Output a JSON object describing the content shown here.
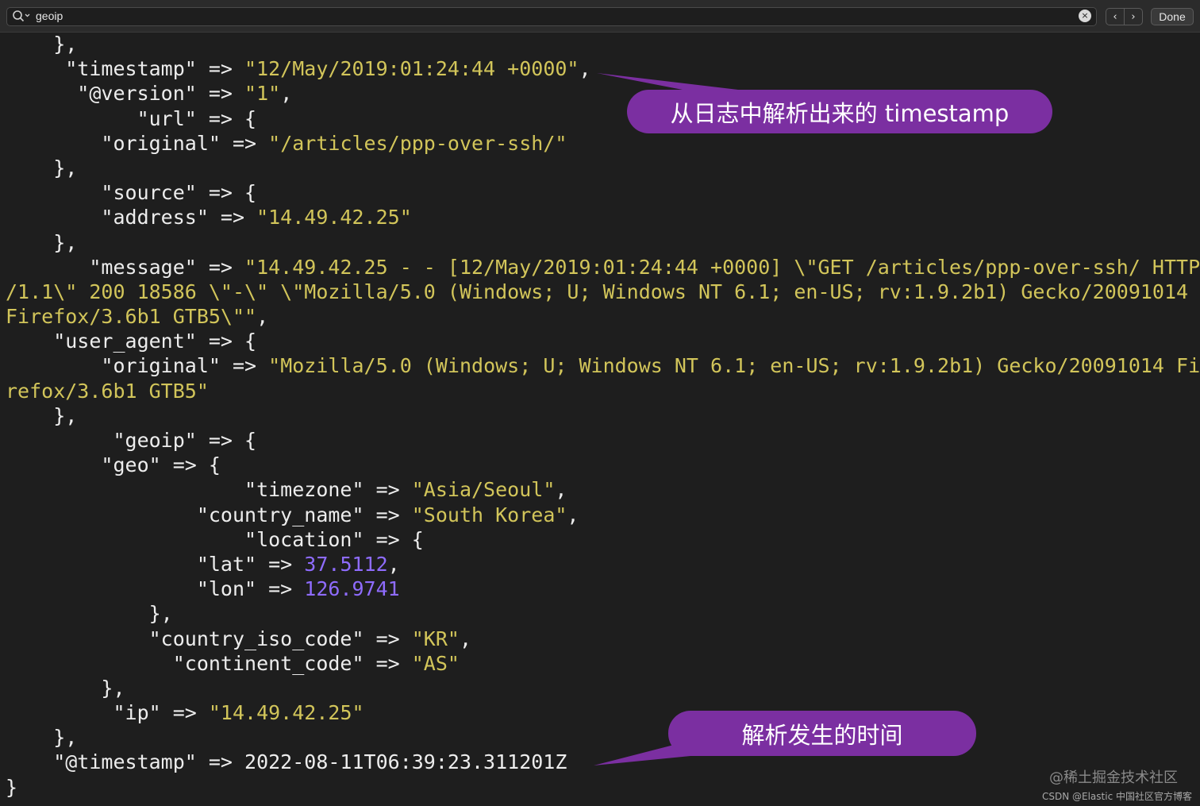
{
  "findbar": {
    "query": "geoip",
    "clear_glyph": "×",
    "prev_glyph": "‹",
    "next_glyph": "›",
    "done_label": "Done"
  },
  "code_lines": [
    [
      "    },"
    ],
    [
      "     \"timestamp\" => ",
      {
        "t": "s",
        "v": "\"12/May/2019:01:24:44 +0000\""
      },
      ","
    ],
    [
      "      \"@version\" => ",
      {
        "t": "s",
        "v": "\"1\""
      },
      ","
    ],
    [
      "           \"url\" => {"
    ],
    [
      "        \"original\" => ",
      {
        "t": "s",
        "v": "\"/articles/ppp-over-ssh/\""
      }
    ],
    [
      "    },"
    ],
    [
      "        \"source\" => {"
    ],
    [
      "        \"address\" => ",
      {
        "t": "s",
        "v": "\"14.49.42.25\""
      }
    ],
    [
      "    },"
    ],
    [
      "       \"message\" => ",
      {
        "t": "s",
        "v": "\"14.49.42.25 - - [12/May/2019:01:24:44 +0000] \\\"GET /articles/ppp-over-ssh/ HTTP"
      }
    ],
    [
      {
        "t": "s",
        "v": "/1.1\\\" 200 18586 \\\"-\\\" \\\"Mozilla/5.0 (Windows; U; Windows NT 6.1; en-US; rv:1.9.2b1) Gecko/20091014"
      }
    ],
    [
      {
        "t": "s",
        "v": "Firefox/3.6b1 GTB5\\\"\""
      },
      ","
    ],
    [
      "    \"user_agent\" => {"
    ],
    [
      "        \"original\" => ",
      {
        "t": "s",
        "v": "\"Mozilla/5.0 (Windows; U; Windows NT 6.1; en-US; rv:1.9.2b1) Gecko/20091014 Fi"
      }
    ],
    [
      {
        "t": "s",
        "v": "refox/3.6b1 GTB5\""
      }
    ],
    [
      "    },"
    ],
    [
      "         \"geoip\" => {"
    ],
    [
      "        \"geo\" => {"
    ],
    [
      "                    \"timezone\" => ",
      {
        "t": "s",
        "v": "\"Asia/Seoul\""
      },
      ","
    ],
    [
      "                \"country_name\" => ",
      {
        "t": "s",
        "v": "\"South Korea\""
      },
      ","
    ],
    [
      "                    \"location\" => {"
    ],
    [
      "                \"lat\" => ",
      {
        "t": "n",
        "v": "37.5112"
      },
      ","
    ],
    [
      "                \"lon\" => ",
      {
        "t": "n",
        "v": "126.9741"
      }
    ],
    [
      "            },"
    ],
    [
      "            \"country_iso_code\" => ",
      {
        "t": "s",
        "v": "\"KR\""
      },
      ","
    ],
    [
      "              \"continent_code\" => ",
      {
        "t": "s",
        "v": "\"AS\""
      }
    ],
    [
      "        },"
    ],
    [
      "         \"ip\" => ",
      {
        "t": "s",
        "v": "\"14.49.42.25\""
      }
    ],
    [
      "    },"
    ],
    [
      "    \"@timestamp\" => 2022-08-11T06:39:23.311201Z"
    ],
    [
      "}"
    ]
  ],
  "callouts": {
    "parsed_timestamp": "从日志中解析出来的 timestamp",
    "event_time": "解析发生的时间"
  },
  "watermark": {
    "line1": "@稀土掘金技术社区",
    "line2": "CSDN @Elastic 中国社区官方博客"
  },
  "colors": {
    "background": "#1e1e1e",
    "string": "#d2c55a",
    "number": "#8f6cff",
    "callout": "#7b2fa1"
  }
}
